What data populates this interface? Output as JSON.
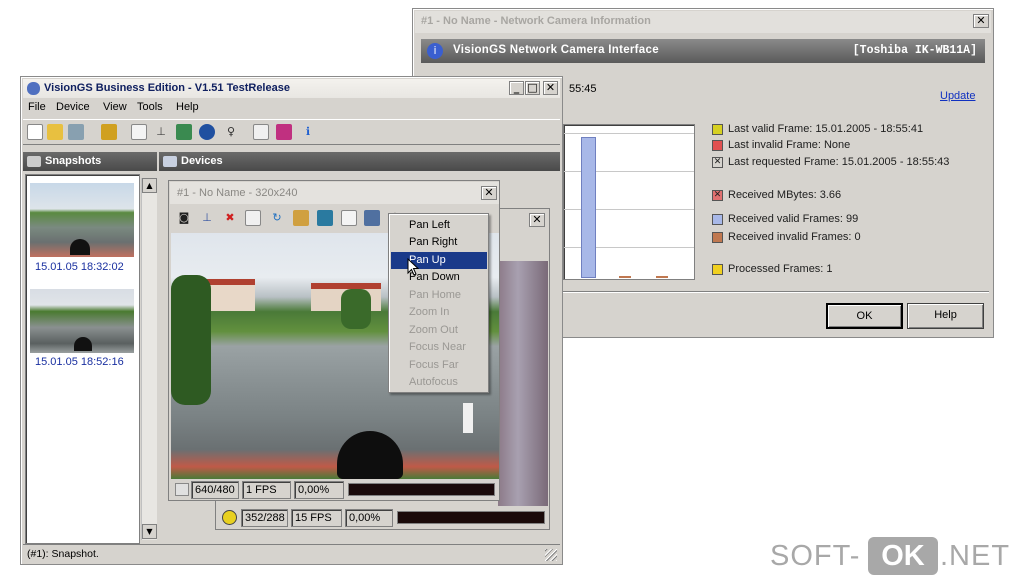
{
  "info_window": {
    "title": "#1 - No Name - Network Camera Information",
    "header_left": "VisionGS Network Camera Interface",
    "header_right": "[Toshiba IK-WB11A]",
    "partial_time": "55:45",
    "update_link": "Update",
    "legend": [
      {
        "label": "Last valid Frame: 15.01.2005 - 18:55:41",
        "color": "#d6d022",
        "icon": "square-swatch"
      },
      {
        "label": "Last invalid Frame: None",
        "color": "#e05050",
        "icon": "square-swatch"
      },
      {
        "label": "Last requested Frame: 15.01.2005 - 18:55:43",
        "color": "#d6d3ce",
        "icon": "crossed-swatch"
      },
      {
        "label": "Received MBytes: 3.66",
        "color": "#e07070",
        "icon": "crossed-swatch"
      },
      {
        "label": "Received valid Frames: 99",
        "color": "#a8b8e8",
        "icon": "square-swatch"
      },
      {
        "label": "Received invalid Frames: 0",
        "color": "#c07850",
        "icon": "square-swatch"
      },
      {
        "label": "Processed Frames: 1",
        "color": "#f0d020",
        "icon": "square-swatch"
      }
    ],
    "ok_button": "OK",
    "help_button": "Help"
  },
  "main_window": {
    "title": "VisionGS Business Edition - V1.51 TestRelease",
    "menu": [
      "File",
      "Device",
      "View",
      "Tools",
      "Help"
    ],
    "toolbar_icons": [
      "new-file-icon",
      "open-folder-icon",
      "tools-icon",
      "device-icon",
      "page-icon",
      "antenna-icon",
      "camera-icon",
      "globe-icon",
      "speech-icon",
      "report-icon",
      "eraser-icon",
      "info-icon"
    ],
    "snapshots_header": "Snapshots",
    "devices_header": "Devices",
    "snapshots": [
      {
        "timestamp": "15.01.05 18:32:02"
      },
      {
        "timestamp": "15.01.05 18:52:16"
      }
    ],
    "status_bar": "(#1): Snapshot."
  },
  "camera_window": {
    "title": "#1 - No Name - 320x240",
    "toolbar_icons": [
      "camera-icon",
      "upload-icon",
      "delete-icon",
      "copy-icon",
      "refresh-icon",
      "tools-icon",
      "image-icon",
      "page-icon",
      "network-icon",
      "ptz-icon"
    ],
    "status": {
      "resolution": "640/480",
      "fps": "1 FPS",
      "percent": "0,00%"
    }
  },
  "second_camera_status": {
    "resolution": "352/288",
    "fps": "15 FPS",
    "percent": "0,00%"
  },
  "context_menu": {
    "items": [
      {
        "label": "Pan Left",
        "enabled": true,
        "selected": false
      },
      {
        "label": "Pan Right",
        "enabled": true,
        "selected": false
      },
      {
        "label": "Pan Up",
        "enabled": true,
        "selected": true
      },
      {
        "label": "Pan Down",
        "enabled": true,
        "selected": false
      },
      {
        "label": "Pan Home",
        "enabled": false,
        "selected": false
      },
      {
        "label": "Zoom In",
        "enabled": false,
        "selected": false
      },
      {
        "label": "Zoom Out",
        "enabled": false,
        "selected": false
      },
      {
        "label": "Focus Near",
        "enabled": false,
        "selected": false
      },
      {
        "label": "Focus Far",
        "enabled": false,
        "selected": false
      },
      {
        "label": "Autofocus",
        "enabled": false,
        "selected": false
      }
    ]
  },
  "watermark": {
    "left": "SOFT-",
    "badge": "OK",
    "right": ".NET"
  }
}
